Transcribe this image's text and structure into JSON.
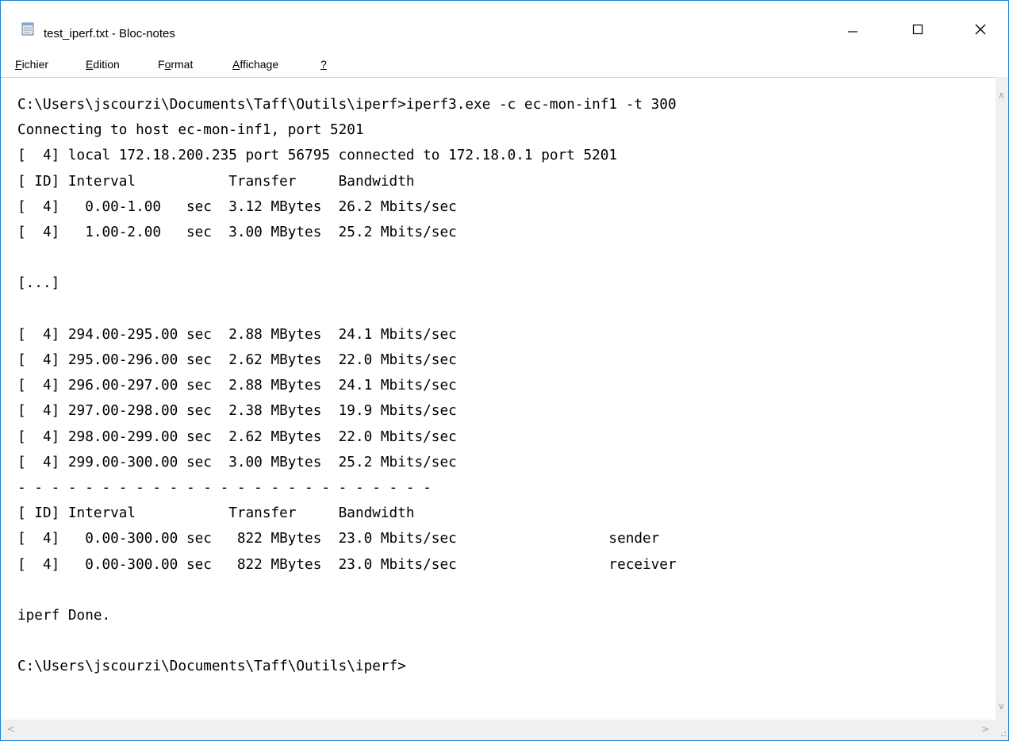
{
  "window": {
    "title": "test_iperf.txt - Bloc-notes"
  },
  "menu": {
    "items": [
      {
        "mnemonic": "F",
        "rest": "ichier"
      },
      {
        "mnemonic": "E",
        "rest": "dition"
      },
      {
        "pre": "F",
        "mnemonic": "o",
        "rest": "rmat"
      },
      {
        "mnemonic": "A",
        "rest": "ffichage"
      },
      {
        "mnemonic": "?",
        "rest": ""
      }
    ]
  },
  "document": {
    "lines": [
      "C:\\Users\\jscourzi\\Documents\\Taff\\Outils\\iperf>iperf3.exe -c ec-mon-inf1 -t 300",
      "Connecting to host ec-mon-inf1, port 5201",
      "[  4] local 172.18.200.235 port 56795 connected to 172.18.0.1 port 5201",
      "[ ID] Interval           Transfer     Bandwidth",
      "[  4]   0.00-1.00   sec  3.12 MBytes  26.2 Mbits/sec",
      "[  4]   1.00-2.00   sec  3.00 MBytes  25.2 Mbits/sec",
      "",
      "[...]",
      "",
      "[  4] 294.00-295.00 sec  2.88 MBytes  24.1 Mbits/sec",
      "[  4] 295.00-296.00 sec  2.62 MBytes  22.0 Mbits/sec",
      "[  4] 296.00-297.00 sec  2.88 MBytes  24.1 Mbits/sec",
      "[  4] 297.00-298.00 sec  2.38 MBytes  19.9 Mbits/sec",
      "[  4] 298.00-299.00 sec  2.62 MBytes  22.0 Mbits/sec",
      "[  4] 299.00-300.00 sec  3.00 MBytes  25.2 Mbits/sec",
      "- - - - - - - - - - - - - - - - - - - - - - - - -",
      "[ ID] Interval           Transfer     Bandwidth",
      "[  4]   0.00-300.00 sec   822 MBytes  23.0 Mbits/sec                  sender",
      "[  4]   0.00-300.00 sec   822 MBytes  23.0 Mbits/sec                  receiver",
      "",
      "iperf Done.",
      "",
      "C:\\Users\\jscourzi\\Documents\\Taff\\Outils\\iperf>"
    ]
  },
  "icons": {
    "app": "notepad-icon",
    "minimize": "minimize-icon",
    "maximize": "maximize-icon",
    "close": "close-icon"
  },
  "colors": {
    "window_border": "#1883d7",
    "scrollbar_bg": "#f0f0f0"
  }
}
